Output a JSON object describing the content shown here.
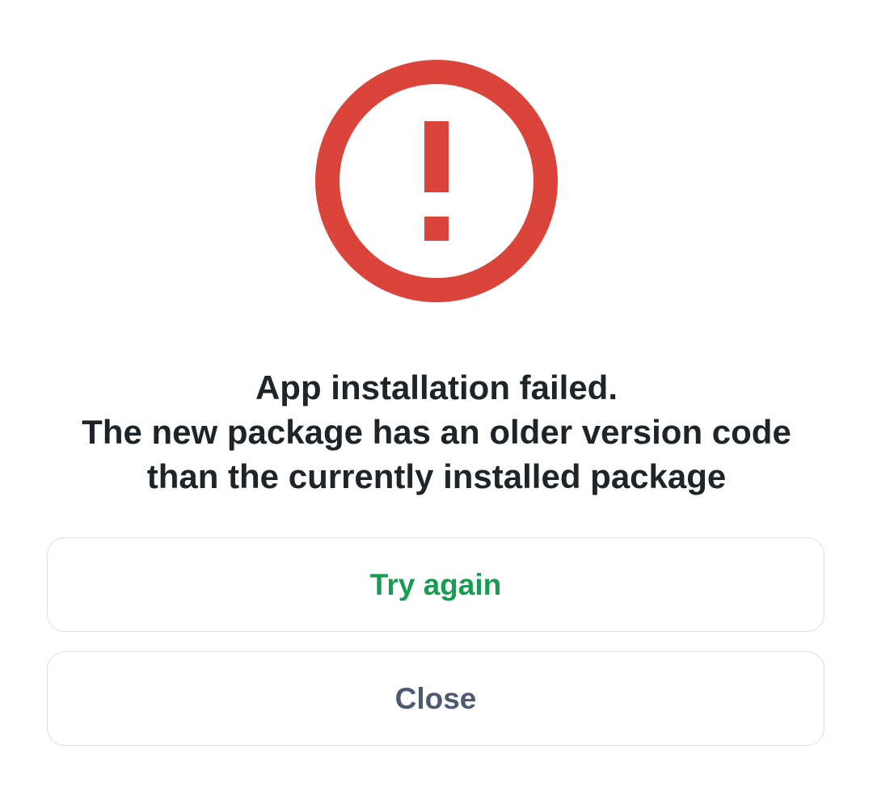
{
  "dialog": {
    "icon": "error-exclamation-circle-icon",
    "icon_color": "#db443a",
    "message_lines": [
      "App installation failed.",
      "The new package has an older version code",
      "than the currently installed package"
    ],
    "message_color": "#1e2428"
  },
  "buttons": {
    "try_again": {
      "label": "Try again",
      "color": "#179c52"
    },
    "close": {
      "label": "Close",
      "color": "#4e5a6e"
    }
  }
}
